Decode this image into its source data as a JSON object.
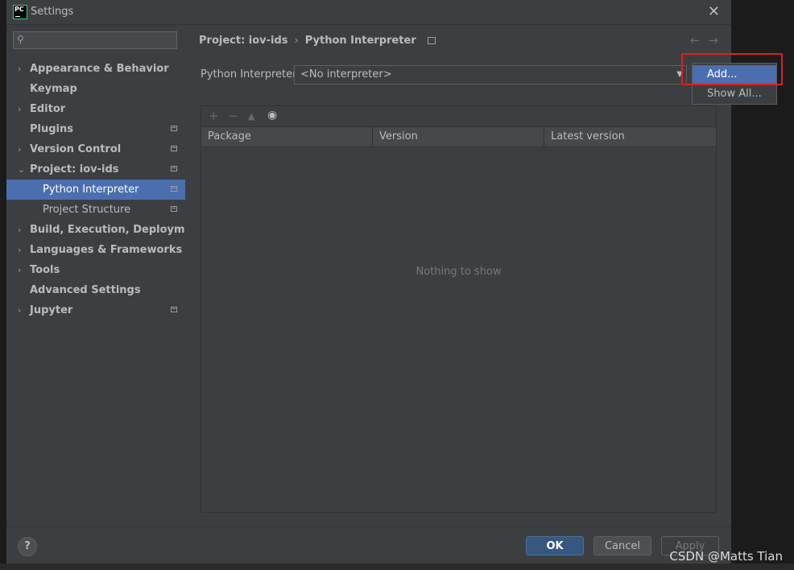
{
  "window": {
    "title": "Settings",
    "logo_text": "PC"
  },
  "sidebar": {
    "search_placeholder": "",
    "items": [
      {
        "label": "Appearance & Behavior"
      },
      {
        "label": "Keymap"
      },
      {
        "label": "Editor"
      },
      {
        "label": "Plugins"
      },
      {
        "label": "Version Control"
      },
      {
        "label": "Project: iov-ids"
      },
      {
        "label": "Python Interpreter"
      },
      {
        "label": "Project Structure"
      },
      {
        "label": "Build, Execution, Deployment"
      },
      {
        "label": "Languages & Frameworks"
      },
      {
        "label": "Tools"
      },
      {
        "label": "Advanced Settings"
      },
      {
        "label": "Jupyter"
      }
    ]
  },
  "breadcrumb": {
    "project": "Project: iov-ids",
    "page": "Python Interpreter"
  },
  "interpreter": {
    "label": "Python Interpreter:",
    "value": "<No interpreter>"
  },
  "packages": {
    "columns": [
      "Package",
      "Version",
      "Latest version"
    ],
    "empty_text": "Nothing to show"
  },
  "popup": {
    "items": [
      "Add...",
      "Show All..."
    ]
  },
  "buttons": {
    "help": "?",
    "ok": "OK",
    "cancel": "Cancel",
    "apply": "Apply"
  },
  "watermark": "CSDN @Matts Tian",
  "colors": {
    "selection": "#4b6eaf",
    "highlight_box": "#e01e1e",
    "ok_button": "#365880"
  }
}
